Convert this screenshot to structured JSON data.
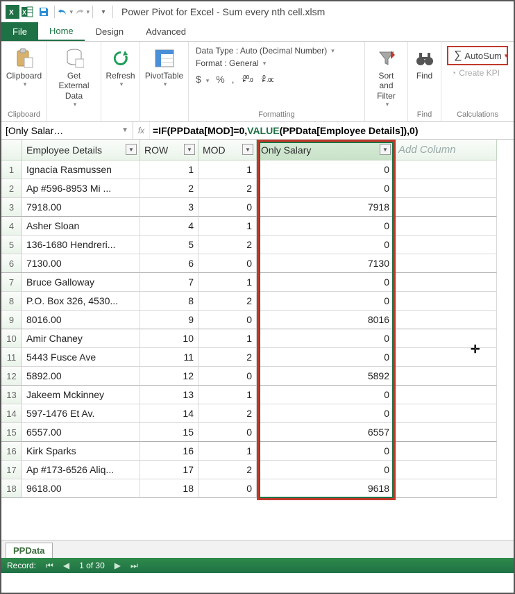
{
  "title": "Power Pivot for Excel - Sum every nth cell.xlsm",
  "tabs": {
    "file": "File",
    "home": "Home",
    "design": "Design",
    "advanced": "Advanced"
  },
  "ribbon": {
    "clipboard": {
      "label": "Clipboard",
      "btn": "Clipboard"
    },
    "getdata": "Get External\nData",
    "refresh": "Refresh",
    "pivot": "PivotTable",
    "fmt_group": "Formatting",
    "datatype": "Data Type : Auto (Decimal Number)",
    "format": "Format : General",
    "mini": [
      "$",
      "%",
      ",",
      ".00→.0",
      ".0→.00"
    ],
    "sort": "Sort and\nFilter",
    "find": "Find",
    "find_group": "Find",
    "calc_group": "Calculations",
    "autosum": "AutoSum",
    "createkpi": "Create KPI"
  },
  "formula_bar": {
    "name": "[Only Salar…",
    "fx": "fx",
    "pre": "=IF(PPData[MOD]=0,",
    "mid": "VALUE",
    "post": "(PPData[Employee Details]),0)"
  },
  "headers": {
    "c1": "Employee Details",
    "c2": "ROW",
    "c3": "MOD",
    "c4": "Only Salary",
    "c5": "Add Column"
  },
  "rows": [
    {
      "n": "1",
      "a": "Ignacia Rasmussen",
      "b": "1",
      "c": "1",
      "d": "0"
    },
    {
      "n": "2",
      "a": "Ap #596-8953 Mi ...",
      "b": "2",
      "c": "2",
      "d": "0"
    },
    {
      "n": "3",
      "a": "7918.00",
      "b": "3",
      "c": "0",
      "d": "7918"
    },
    {
      "n": "4",
      "a": "Asher Sloan",
      "b": "4",
      "c": "1",
      "d": "0"
    },
    {
      "n": "5",
      "a": "136-1680 Hendreri...",
      "b": "5",
      "c": "2",
      "d": "0"
    },
    {
      "n": "6",
      "a": "7130.00",
      "b": "6",
      "c": "0",
      "d": "7130"
    },
    {
      "n": "7",
      "a": "Bruce Galloway",
      "b": "7",
      "c": "1",
      "d": "0"
    },
    {
      "n": "8",
      "a": "P.O. Box 326, 4530...",
      "b": "8",
      "c": "2",
      "d": "0"
    },
    {
      "n": "9",
      "a": "8016.00",
      "b": "9",
      "c": "0",
      "d": "8016"
    },
    {
      "n": "10",
      "a": "Amir Chaney",
      "b": "10",
      "c": "1",
      "d": "0"
    },
    {
      "n": "11",
      "a": "5443 Fusce Ave",
      "b": "11",
      "c": "2",
      "d": "0"
    },
    {
      "n": "12",
      "a": "5892.00",
      "b": "12",
      "c": "0",
      "d": "5892"
    },
    {
      "n": "13",
      "a": "Jakeem Mckinney",
      "b": "13",
      "c": "1",
      "d": "0"
    },
    {
      "n": "14",
      "a": "597-1476 Et Av.",
      "b": "14",
      "c": "2",
      "d": "0"
    },
    {
      "n": "15",
      "a": "6557.00",
      "b": "15",
      "c": "0",
      "d": "6557"
    },
    {
      "n": "16",
      "a": "Kirk Sparks",
      "b": "16",
      "c": "1",
      "d": "0"
    },
    {
      "n": "17",
      "a": "Ap #173-6526 Aliq...",
      "b": "17",
      "c": "2",
      "d": "0"
    },
    {
      "n": "18",
      "a": "9618.00",
      "b": "18",
      "c": "0",
      "d": "9618"
    }
  ],
  "sheet": "PPData",
  "status": {
    "record": "Record:",
    "pos": "1 of 30"
  }
}
